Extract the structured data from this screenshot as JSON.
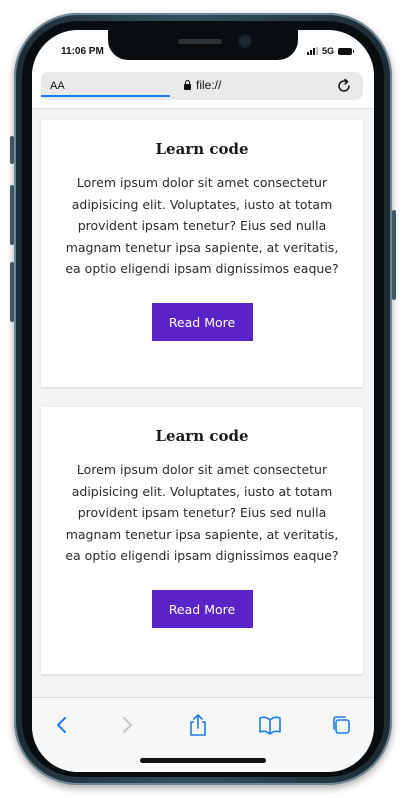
{
  "status_bar": {
    "time": "11:06 PM",
    "network": "5G"
  },
  "address_bar": {
    "text_size_label": "AA",
    "url": "file://",
    "lock_icon": "lock-icon",
    "reload_icon": "reload-icon"
  },
  "cards": [
    {
      "title": "Learn code",
      "text": "Lorem ipsum dolor sit amet consectetur adipisicing elit. Voluptates, iusto at totam provident ipsam tenetur? Eius sed nulla magnam tenetur ipsa sapiente, at veritatis, ea optio eligendi ipsam dignissimos eaque?",
      "button": "Read More"
    },
    {
      "title": "Learn code",
      "text": "Lorem ipsum dolor sit amet consectetur adipisicing elit. Voluptates, iusto at totam provident ipsam tenetur? Eius sed nulla magnam tenetur ipsa sapiente, at veritatis, ea optio eligendi ipsam dignissimos eaque?",
      "button": "Read More"
    }
  ],
  "toolbar": {
    "icons": [
      "back-icon",
      "forward-icon",
      "share-icon",
      "bookmarks-icon",
      "tabs-icon"
    ]
  },
  "colors": {
    "button_bg": "#5a24c8",
    "accent": "#1a7cf5",
    "page_bg": "#f4f4f5"
  }
}
